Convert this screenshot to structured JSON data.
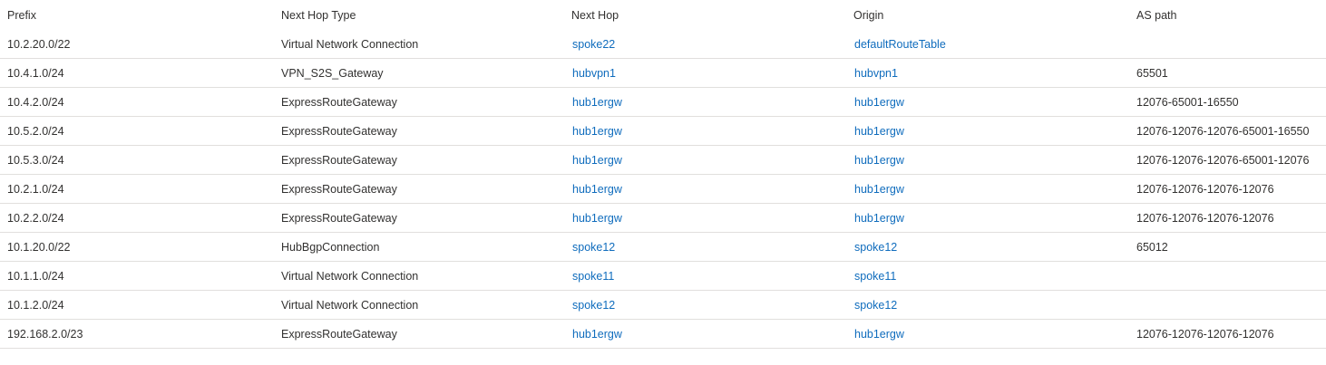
{
  "columns": {
    "prefix": "Prefix",
    "next_hop_type": "Next Hop Type",
    "next_hop": "Next Hop",
    "origin": "Origin",
    "as_path": "AS path"
  },
  "rows": [
    {
      "prefix": "10.2.20.0/22",
      "next_hop_type": "Virtual Network Connection",
      "next_hop": "spoke22",
      "origin": "defaultRouteTable",
      "as_path": ""
    },
    {
      "prefix": "10.4.1.0/24",
      "next_hop_type": "VPN_S2S_Gateway",
      "next_hop": "hubvpn1",
      "origin": "hubvpn1",
      "as_path": "65501"
    },
    {
      "prefix": "10.4.2.0/24",
      "next_hop_type": "ExpressRouteGateway",
      "next_hop": "hub1ergw",
      "origin": "hub1ergw",
      "as_path": "12076-65001-16550"
    },
    {
      "prefix": "10.5.2.0/24",
      "next_hop_type": "ExpressRouteGateway",
      "next_hop": "hub1ergw",
      "origin": "hub1ergw",
      "as_path": "12076-12076-12076-65001-16550"
    },
    {
      "prefix": "10.5.3.0/24",
      "next_hop_type": "ExpressRouteGateway",
      "next_hop": "hub1ergw",
      "origin": "hub1ergw",
      "as_path": "12076-12076-12076-65001-12076"
    },
    {
      "prefix": "10.2.1.0/24",
      "next_hop_type": "ExpressRouteGateway",
      "next_hop": "hub1ergw",
      "origin": "hub1ergw",
      "as_path": "12076-12076-12076-12076"
    },
    {
      "prefix": "10.2.2.0/24",
      "next_hop_type": "ExpressRouteGateway",
      "next_hop": "hub1ergw",
      "origin": "hub1ergw",
      "as_path": "12076-12076-12076-12076"
    },
    {
      "prefix": "10.1.20.0/22",
      "next_hop_type": "HubBgpConnection",
      "next_hop": "spoke12",
      "origin": "spoke12",
      "as_path": "65012"
    },
    {
      "prefix": "10.1.1.0/24",
      "next_hop_type": "Virtual Network Connection",
      "next_hop": "spoke11",
      "origin": "spoke11",
      "as_path": ""
    },
    {
      "prefix": "10.1.2.0/24",
      "next_hop_type": "Virtual Network Connection",
      "next_hop": "spoke12",
      "origin": "spoke12",
      "as_path": ""
    },
    {
      "prefix": "192.168.2.0/23",
      "next_hop_type": "ExpressRouteGateway",
      "next_hop": "hub1ergw",
      "origin": "hub1ergw",
      "as_path": "12076-12076-12076-12076"
    }
  ],
  "colors": {
    "text": "#323130",
    "link": "#0f6cbd",
    "divider": "#e1dfdd"
  }
}
